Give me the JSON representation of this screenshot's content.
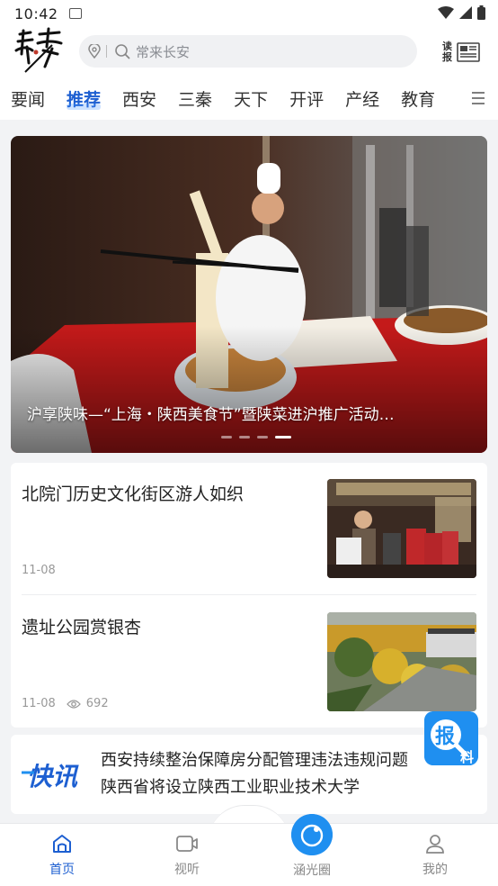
{
  "status_bar": {
    "time": "10:42"
  },
  "header": {
    "search_placeholder": "常来长安",
    "read_news_label": "读报"
  },
  "tabs": [
    {
      "label": "要闻",
      "active": false
    },
    {
      "label": "推荐",
      "active": true
    },
    {
      "label": "西安",
      "active": false
    },
    {
      "label": "三秦",
      "active": false
    },
    {
      "label": "天下",
      "active": false
    },
    {
      "label": "开评",
      "active": false
    },
    {
      "label": "产经",
      "active": false
    },
    {
      "label": "教育",
      "active": false
    }
  ],
  "banner": {
    "caption": "沪享陕味—“上海・陕西美食节”暨陕菜进沪推广活动…",
    "slide_count": 4,
    "active_slide": 4
  },
  "news": [
    {
      "title": "北院门历史文化街区游人如织",
      "date": "11-08",
      "views": ""
    },
    {
      "title": "遗址公园赏银杏",
      "date": "11-08",
      "views": "692"
    }
  ],
  "flash": {
    "logo_text": "快讯",
    "items": [
      "西安持续整治保障房分配管理违法违规问题",
      "陕西省将设立陕西工业职业技术大学"
    ]
  },
  "report_button": {
    "label_main": "报",
    "label_sub": "料"
  },
  "bottom_nav": {
    "items": [
      {
        "label": "首页",
        "active": true
      },
      {
        "label": "视听",
        "active": false
      },
      {
        "label": "涵光圈",
        "active": false
      },
      {
        "label": "我的",
        "active": false
      }
    ]
  },
  "colors": {
    "accent": "#1d5fd1",
    "brand_blue": "#1f8ff0"
  }
}
